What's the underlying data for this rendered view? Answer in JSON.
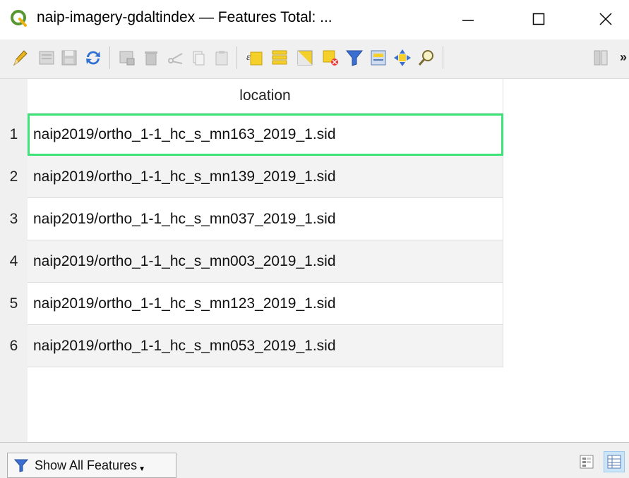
{
  "window": {
    "title": "naip-imagery-gdaltindex — Features Total: ...",
    "minimize_label": "—",
    "maximize_label": "☐",
    "close_label": "✕"
  },
  "toolbar": {
    "icons": [
      "pencil-edit-icon",
      "multi-edit-icon",
      "save-edits-icon",
      "reload-icon",
      "add-feature-icon",
      "delete-feature-icon",
      "cut-icon",
      "copy-icon",
      "paste-icon",
      "select-expression-icon",
      "select-all-icon",
      "invert-selection-icon",
      "deselect-all-icon",
      "filter-selection-icon",
      "move-selection-top-icon",
      "pan-to-selection-icon",
      "zoom-to-selection-icon",
      "new-field-icon"
    ],
    "more_label": "»"
  },
  "table": {
    "column_header": "location",
    "rows": [
      {
        "num": "1",
        "location": "naip2019/ortho_1-1_hc_s_mn163_2019_1.sid"
      },
      {
        "num": "2",
        "location": "naip2019/ortho_1-1_hc_s_mn139_2019_1.sid"
      },
      {
        "num": "3",
        "location": "naip2019/ortho_1-1_hc_s_mn037_2019_1.sid"
      },
      {
        "num": "4",
        "location": "naip2019/ortho_1-1_hc_s_mn003_2019_1.sid"
      },
      {
        "num": "5",
        "location": "naip2019/ortho_1-1_hc_s_mn123_2019_1.sid"
      },
      {
        "num": "6",
        "location": "naip2019/ortho_1-1_hc_s_mn053_2019_1.sid"
      }
    ]
  },
  "bottom": {
    "filter_label": "Show All Features"
  },
  "colors": {
    "current_cell_border": "#3ee47a",
    "qgis_green": "#589632",
    "qgis_yellow": "#eeb217"
  }
}
